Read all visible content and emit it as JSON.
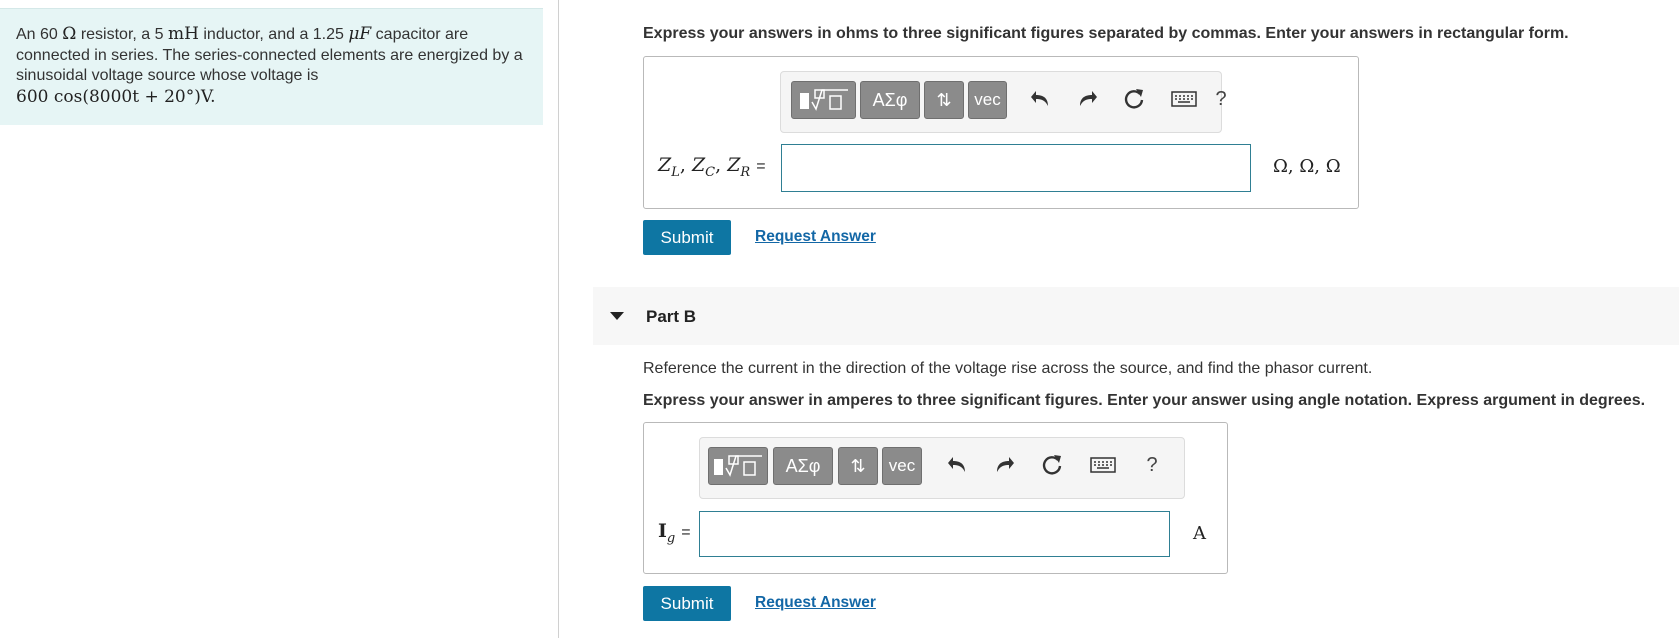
{
  "problem": {
    "text_prefix": "An 60 ",
    "ohm_symbol": "Ω",
    "text_1": " resistor, a 5 ",
    "mh": "mH",
    "text_2": " inductor, and a 1.25 ",
    "uf": "μF",
    "text_3": " capacitor are connected in series. The series-connected elements are energized by a sinusoidal voltage source whose voltage is",
    "voltage_expr": "600 cos(8000t + 20°)V."
  },
  "part_a": {
    "instruction": "Express your answers in ohms to three significant figures separated by commas. Enter your answers in rectangular form.",
    "label_zl": "Z",
    "sub_l": "L",
    "label_zc": "Z",
    "sub_c": "C",
    "label_zr": "Z",
    "sub_r": "R",
    "equals": "=",
    "input_value": "",
    "units": "Ω, Ω, Ω",
    "submit": "Submit",
    "request": "Request Answer"
  },
  "part_b": {
    "title": "Part B",
    "description": "Reference the current in the direction of the voltage rise across the source, and find the phasor current.",
    "instruction": "Express your answer in amperes to three significant figures. Enter your answer using angle notation. Express argument in degrees.",
    "label_i": "I",
    "sub_g": "g",
    "equals": "=",
    "input_value": "",
    "unit": "A",
    "submit": "Submit",
    "request": "Request Answer"
  },
  "toolbar": {
    "greek": "ΑΣφ",
    "arrows": "⇅",
    "vec": "vec",
    "help": "?"
  },
  "icons": [
    "templates-icon",
    "undo-icon",
    "redo-icon",
    "reset-icon",
    "keyboard-icon",
    "help-icon"
  ]
}
